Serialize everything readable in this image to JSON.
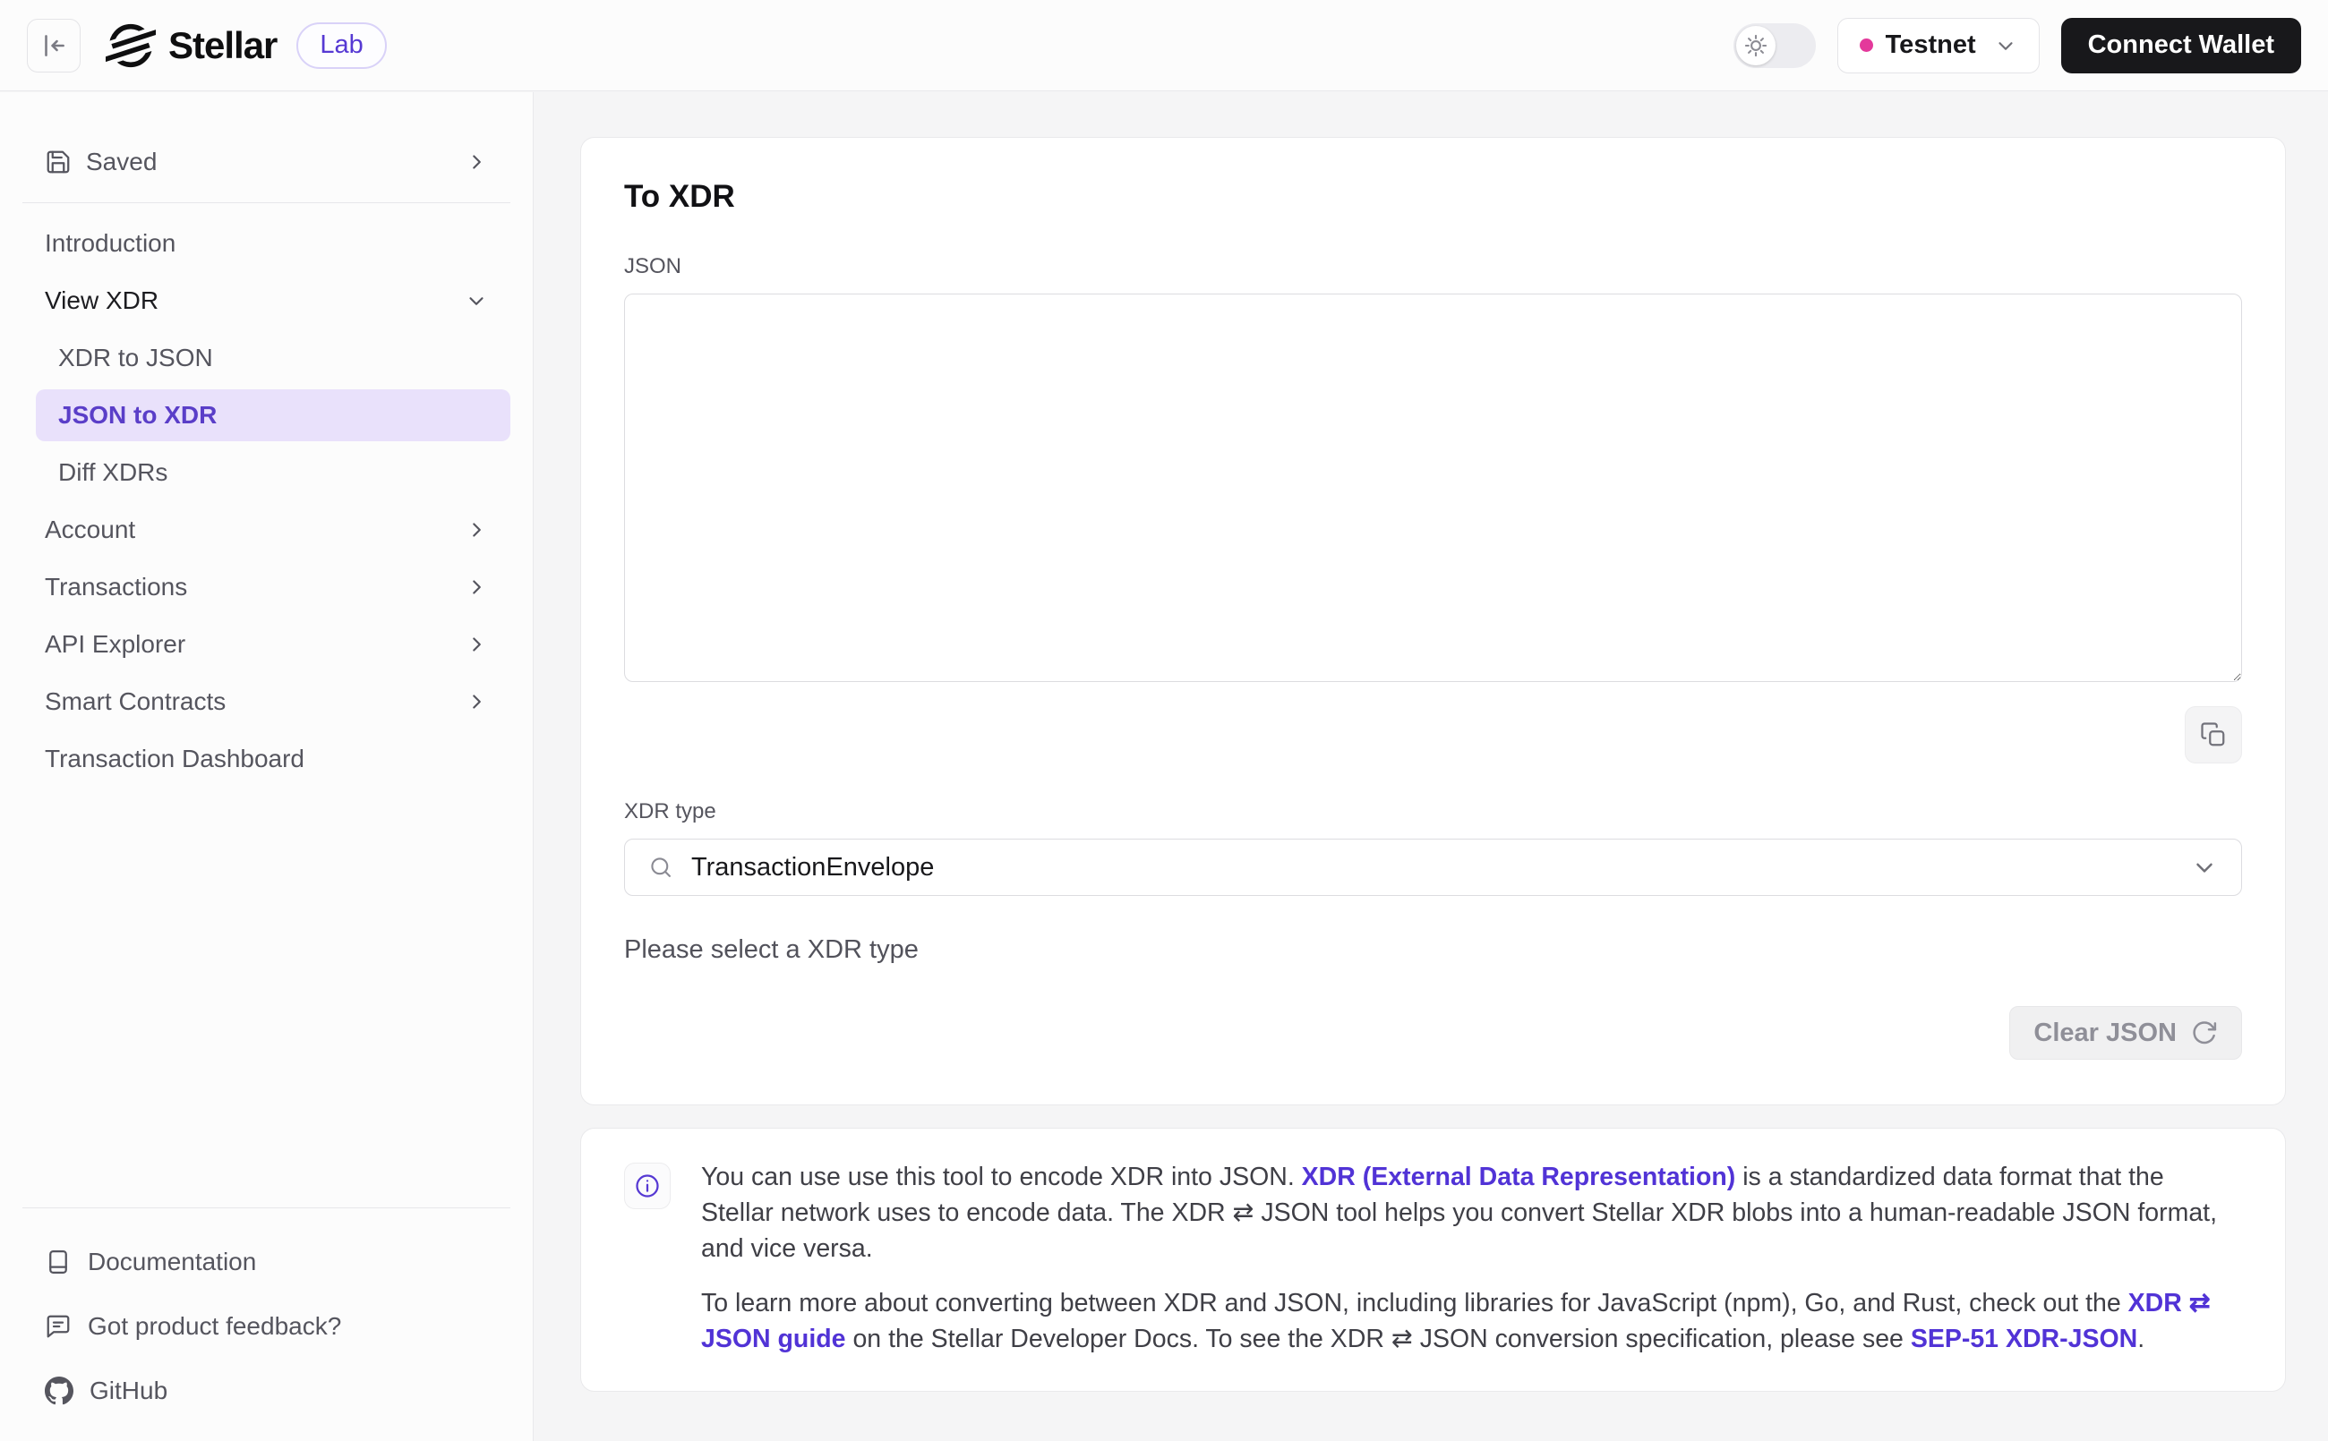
{
  "header": {
    "logo_text": "Stellar",
    "badge_label": "Lab",
    "network_label": "Testnet",
    "connect_wallet_label": "Connect Wallet"
  },
  "sidebar": {
    "saved_label": "Saved",
    "items": [
      {
        "label": "Introduction"
      },
      {
        "label": "View XDR",
        "expanded": true
      },
      {
        "label": "XDR to JSON",
        "child": true
      },
      {
        "label": "JSON to XDR",
        "child": true,
        "active": true
      },
      {
        "label": "Diff XDRs",
        "child": true
      },
      {
        "label": "Account"
      },
      {
        "label": "Transactions"
      },
      {
        "label": "API Explorer"
      },
      {
        "label": "Smart Contracts"
      },
      {
        "label": "Transaction Dashboard"
      }
    ],
    "footer": [
      {
        "label": "Documentation"
      },
      {
        "label": "Got product feedback?"
      },
      {
        "label": "GitHub"
      }
    ]
  },
  "tool": {
    "title": "To XDR",
    "json_field_label": "JSON",
    "json_value": "",
    "xdr_type_label": "XDR type",
    "xdr_type_value": "TransactionEnvelope",
    "validation_message": "Please select a XDR type",
    "clear_button_label": "Clear JSON"
  },
  "info_box": {
    "p1_text_1": "You can use use this tool to encode XDR into JSON. ",
    "p1_link": "XDR (External Data Representation)",
    "p1_text_2": " is a standardized data format that the Stellar network uses to encode data. The XDR ⇄ JSON tool helps you convert Stellar XDR blobs into a human-readable JSON format, and vice versa.",
    "p2_text_1": "To learn more about converting between XDR and JSON, including libraries for JavaScript (npm), Go, and Rust, check out the ",
    "p2_link_1": "XDR ⇄ JSON guide",
    "p2_text_2": " on the Stellar Developer Docs. To see the XDR ⇄ JSON conversion specification, please see ",
    "p2_link_2": "SEP-51 XDR-JSON",
    "p2_text_3": "."
  },
  "colors": {
    "accent_purple": "#5639d3",
    "link_purple": "#5133d6",
    "testnet_pink": "#e4399b",
    "wallet_button_bg": "#18181b",
    "active_item_bg": "#e9e1fb"
  }
}
